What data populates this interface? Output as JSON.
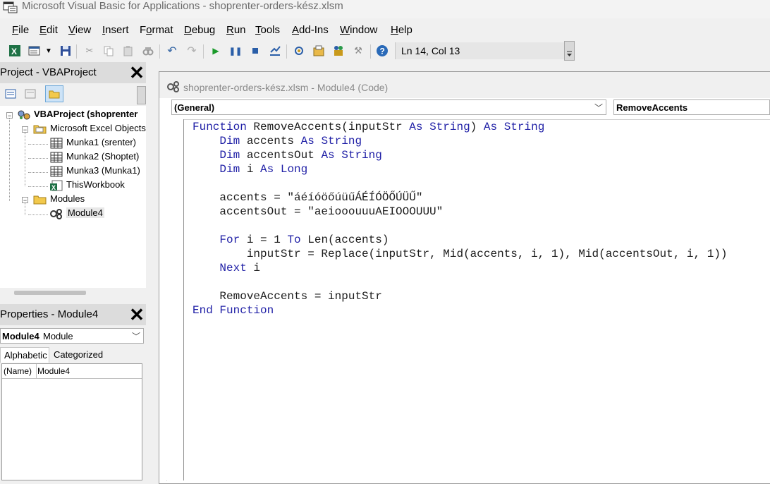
{
  "window": {
    "title": "Microsoft Visual Basic for Applications - shoprenter-orders-kész.xlsm"
  },
  "menu": [
    {
      "label": "File",
      "name": "menu-file"
    },
    {
      "label": "Edit",
      "name": "menu-edit"
    },
    {
      "label": "View",
      "name": "menu-view"
    },
    {
      "label": "Insert",
      "name": "menu-insert"
    },
    {
      "label": "Format",
      "name": "menu-format"
    },
    {
      "label": "Debug",
      "name": "menu-debug"
    },
    {
      "label": "Run",
      "name": "menu-run"
    },
    {
      "label": "Tools",
      "name": "menu-tools"
    },
    {
      "label": "Add-Ins",
      "name": "menu-add-ins"
    },
    {
      "label": "Window",
      "name": "menu-window"
    },
    {
      "label": "Help",
      "name": "menu-help"
    }
  ],
  "toolbar": {
    "position": "Ln 14, Col 13",
    "icons": [
      "excel-view-icon",
      "insert-module-icon",
      "save-icon",
      "cut-icon",
      "copy-icon",
      "paste-icon",
      "find-icon",
      "undo-icon",
      "redo-icon",
      "run-icon",
      "break-icon",
      "reset-icon",
      "design-mode-icon",
      "project-explorer-icon",
      "properties-icon",
      "object-browser-icon",
      "toolbox-icon",
      "help-icon"
    ]
  },
  "project_panel": {
    "title": "Project - VBAProject",
    "tree": {
      "root": "VBAProject (shoprenter",
      "excel_objects": "Microsoft Excel Objects",
      "sheets": [
        "Munka1 (srenter)",
        "Munka2 (Shoptet)",
        "Munka3 (Munka1)"
      ],
      "workbook": "ThisWorkbook",
      "modules_folder": "Modules",
      "module": "Module4"
    }
  },
  "properties_panel": {
    "title": "Properties - Module4",
    "object_name": "Module4",
    "object_type": "Module",
    "tabs": [
      "Alphabetic",
      "Categorized"
    ],
    "row": {
      "name": "(Name)",
      "value": "Module4"
    }
  },
  "code_window": {
    "title": "shoprenter-orders-kész.xlsm - Module4 (Code)",
    "object_combo": "(General)",
    "procedure_combo": "RemoveAccents",
    "lines": [
      "Function RemoveAccents(inputStr As String) As String",
      "    Dim accents As String",
      "    Dim accentsOut As String",
      "    Dim i As Long",
      "",
      "    accents = \"áéíóöőúüűÁÉÍÓÖŐÚÜŰ\"",
      "    accentsOut = \"aeiooouuuAEIOOOUUU\"",
      "",
      "    For i = 1 To Len(accents)",
      "        inputStr = Replace(inputStr, Mid(accents, i, 1), Mid(accentsOut, i, 1))",
      "    Next i",
      "",
      "    RemoveAccents = inputStr",
      "End Function"
    ]
  }
}
